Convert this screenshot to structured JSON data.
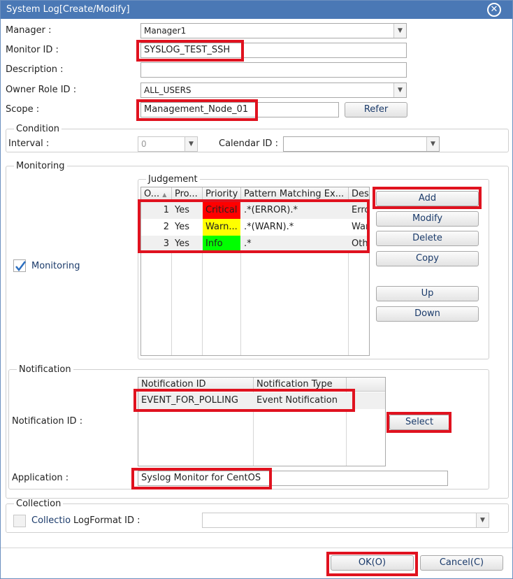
{
  "window": {
    "title": "System Log[Create/Modify]"
  },
  "general": {
    "manager_label": "Manager :",
    "manager_value": "Manager1",
    "monitor_id_label": "Monitor ID :",
    "monitor_id_value": "SYSLOG_TEST_SSH",
    "description_label": "Description :",
    "description_value": "",
    "owner_role_label": "Owner Role ID :",
    "owner_role_value": "ALL_USERS",
    "scope_label": "Scope :",
    "scope_value": "Management_Node_01",
    "refer_button": "Refer"
  },
  "condition": {
    "title": "Condition",
    "interval_label": "Interval :",
    "interval_value": "0",
    "calendar_label": "Calendar ID :",
    "calendar_value": ""
  },
  "monitoring": {
    "title": "Monitoring",
    "checkbox_label": "Monitoring",
    "checked": true,
    "judgement": {
      "title": "Judgement",
      "columns": [
        "O...",
        "Pro...",
        "Priority",
        "Pattern Matching Ex...",
        "Des"
      ],
      "rows": [
        {
          "order": "1",
          "process": "Yes",
          "priority": "Critical",
          "pattern": ".*(ERROR).*",
          "desc": "Erro",
          "color": "#ff0000"
        },
        {
          "order": "2",
          "process": "Yes",
          "priority": "Warn...",
          "pattern": ".*(WARN).*",
          "desc": "War",
          "color": "#ffff00"
        },
        {
          "order": "3",
          "process": "Yes",
          "priority": "Info",
          "pattern": ".*",
          "desc": "Oth",
          "color": "#00ff00"
        }
      ]
    },
    "buttons": {
      "add": "Add",
      "modify": "Modify",
      "delete": "Delete",
      "copy": "Copy",
      "up": "Up",
      "down": "Down"
    }
  },
  "notification": {
    "title": "Notification",
    "id_label": "Notification ID :",
    "columns": [
      "Notification ID",
      "Notification Type"
    ],
    "rows": [
      {
        "id": "EVENT_FOR_POLLING",
        "type": "Event Notification"
      }
    ],
    "select_button": "Select",
    "application_label": "Application :",
    "application_value": "Syslog Monitor for CentOS"
  },
  "collection": {
    "title": "Collection",
    "checkbox_label": "Collectio",
    "logformat_label": "LogFormat ID :",
    "logformat_value": ""
  },
  "footer": {
    "ok": "OK(O)",
    "cancel": "Cancel(C)"
  },
  "colors": {
    "titlebar": "#4a78b5",
    "highlight": "#e0121f"
  }
}
